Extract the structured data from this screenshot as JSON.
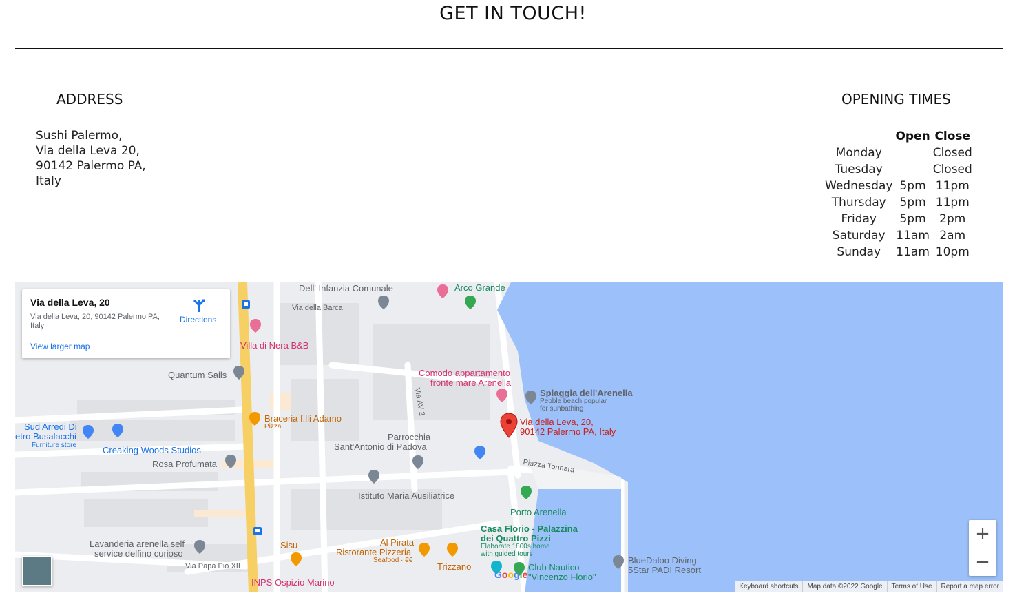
{
  "page": {
    "title": "GET IN TOUCH!"
  },
  "address": {
    "heading": "ADDRESS",
    "lines": [
      "Sushi Palermo,",
      "Via della Leva 20,",
      "90142 Palermo PA,",
      "Italy"
    ]
  },
  "opening": {
    "heading": "OPENING TIMES",
    "col_open": "Open",
    "col_close": "Close",
    "rows": [
      {
        "day": "Monday",
        "open": "",
        "close": "Closed"
      },
      {
        "day": "Tuesday",
        "open": "",
        "close": "Closed"
      },
      {
        "day": "Wednesday",
        "open": "5pm",
        "close": "11pm"
      },
      {
        "day": "Thursday",
        "open": "5pm",
        "close": "11pm"
      },
      {
        "day": "Friday",
        "open": "5pm",
        "close": "2pm"
      },
      {
        "day": "Saturday",
        "open": "11am",
        "close": "2am"
      },
      {
        "day": "Sunday",
        "open": "11am",
        "close": "10pm"
      }
    ]
  },
  "map": {
    "info_card": {
      "title": "Via della Leva, 20",
      "address": "Via della Leva, 20, 90142 Palermo PA, Italy",
      "directions_label": "Directions",
      "view_larger": "View larger map"
    },
    "labels": {
      "infanzia": "Dell' Infanzia Comunale",
      "barca": "Via della Barca",
      "arco": "Arco Grande",
      "villa": "Villa di Nera B&B",
      "quantum": "Quantum Sails",
      "comodo1": "Comodo appartamento",
      "comodo2": "fronte mare Arenella",
      "av2": "Via AV 2",
      "spiaggia": "Spiaggia dell'Arenella",
      "spiaggia_sub1": "Pebble beach popular",
      "spiaggia_sub2": "for sunbathing",
      "marker1": "Via della Leva, 20,",
      "marker2": "90142 Palermo PA, Italy",
      "braceria": "Braceria f.lli Adamo",
      "pizza": "Pizza",
      "sud1": "Sud Arredi Di",
      "sud2": "etro Busalacchi",
      "sud3": "Furniture store",
      "creaking": "Creaking Woods Studios",
      "parrocchia1": "Parrocchia",
      "parrocchia2": "Sant'Antonio di Padova",
      "rosa": "Rosa Profumata",
      "tonnara": "Piazza Tonnara",
      "istituto": "Istituto Maria Ausiliatrice",
      "porto": "Porto Arenella",
      "casa1": "Casa Florio - Palazzina",
      "casa2": "dei Quattro Pizzi",
      "casa3": "Elaborate 1800s home",
      "casa4": "with guided tours",
      "lavanderia1": "Lavanderia arenella self",
      "lavanderia2": "service delfino curioso",
      "sisu": "Sisu",
      "pirata1": "Al Pirata",
      "pirata2": "Ristorante Pizzeria",
      "pirata3": "Seafood · €€",
      "trizzano": "Trizzano",
      "papa": "Via Papa Pio XII",
      "inps": "INPS Ospizio Marino",
      "club1": "Club Nautico",
      "club2": "\"Vincenzo Florio\"",
      "blue1": "BlueDaloo Diving",
      "blue2": "5Star PADI Resort"
    },
    "zoom_in": "+",
    "zoom_out": "−",
    "google": "Google",
    "attribution": [
      "Keyboard shortcuts",
      "Map data ©2022 Google",
      "Terms of Use",
      "Report a map error"
    ]
  }
}
